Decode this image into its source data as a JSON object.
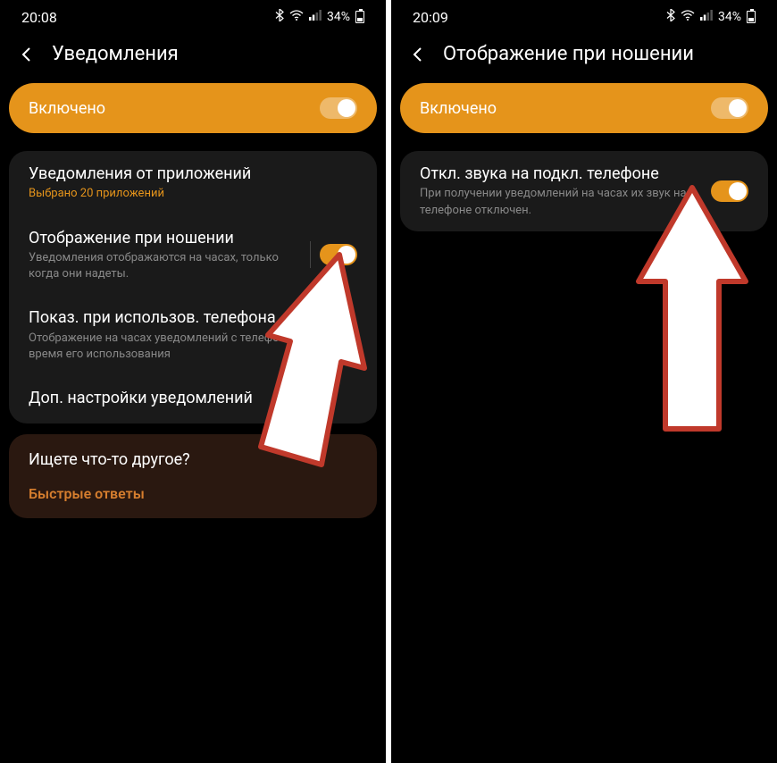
{
  "left": {
    "status": {
      "time": "20:08",
      "battery": "34%"
    },
    "header": {
      "title": "Уведомления"
    },
    "enabled": {
      "label": "Включено",
      "on": true
    },
    "settings": [
      {
        "title": "Уведомления от приложений",
        "subtitle": "Выбрано 20 приложений",
        "subtitleOrange": true,
        "hasToggle": false
      },
      {
        "title": "Отображение при ношении",
        "subtitle": "Уведомления отображаются на часах, только когда они надеты.",
        "subtitleOrange": false,
        "hasToggle": true,
        "toggleOn": true
      },
      {
        "title": "Показ. при использов. телефона",
        "subtitle": "Отображение на часах уведомлений с телефона во время его использования",
        "subtitleOrange": false,
        "hasToggle": true,
        "toggleOn": true
      },
      {
        "title": "Доп. настройки уведомлений",
        "subtitle": "",
        "subtitleOrange": false,
        "hasToggle": false
      }
    ],
    "other": {
      "title": "Ищете что-то другое?",
      "link": "Быстрые ответы"
    }
  },
  "right": {
    "status": {
      "time": "20:09",
      "battery": "34%"
    },
    "header": {
      "title": "Отображение при ношении"
    },
    "enabled": {
      "label": "Включено",
      "on": true
    },
    "settings": [
      {
        "title": "Откл. звука на подкл. телефоне",
        "subtitle": "При получении уведомлений на часах их звук на телефоне отключен.",
        "subtitleOrange": false,
        "hasToggle": true,
        "toggleOn": true
      }
    ]
  },
  "icons": {
    "bluetooth": "bluetooth-icon",
    "wifi": "wifi-icon",
    "signal": "signal-icon",
    "battery": "battery-icon"
  }
}
